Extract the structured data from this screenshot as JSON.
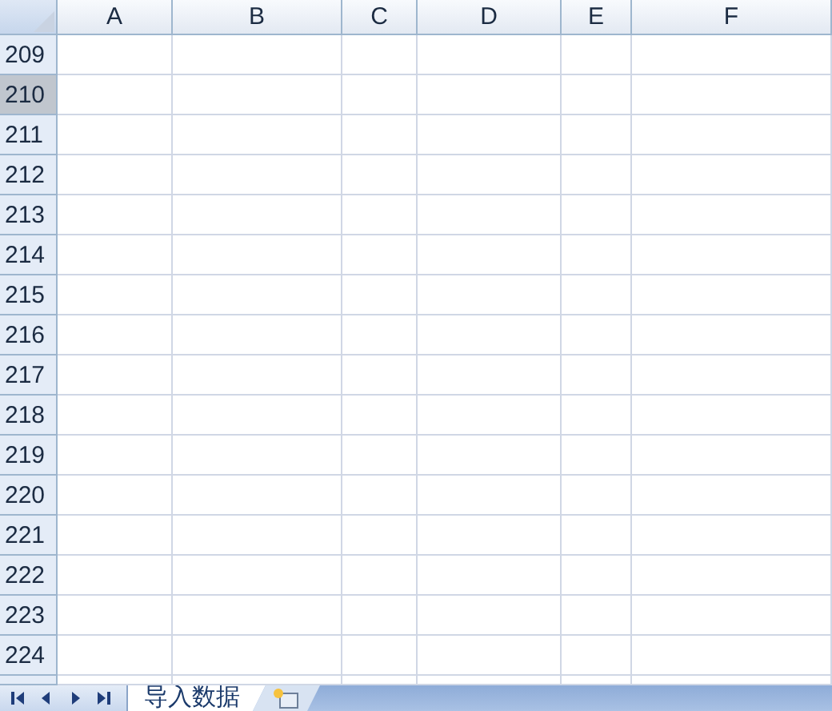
{
  "columns": [
    {
      "label": "A"
    },
    {
      "label": "B"
    },
    {
      "label": "C"
    },
    {
      "label": "D"
    },
    {
      "label": "E"
    },
    {
      "label": "F"
    }
  ],
  "rows": [
    {
      "label": "209",
      "selected": false
    },
    {
      "label": "210",
      "selected": true
    },
    {
      "label": "211",
      "selected": false
    },
    {
      "label": "212",
      "selected": false
    },
    {
      "label": "213",
      "selected": false
    },
    {
      "label": "214",
      "selected": false
    },
    {
      "label": "215",
      "selected": false
    },
    {
      "label": "216",
      "selected": false
    },
    {
      "label": "217",
      "selected": false
    },
    {
      "label": "218",
      "selected": false
    },
    {
      "label": "219",
      "selected": false
    },
    {
      "label": "220",
      "selected": false
    },
    {
      "label": "221",
      "selected": false
    },
    {
      "label": "222",
      "selected": false
    },
    {
      "label": "223",
      "selected": false
    },
    {
      "label": "224",
      "selected": false
    }
  ],
  "sheet_tabs": [
    {
      "label": "导入数据",
      "selected": true
    }
  ]
}
